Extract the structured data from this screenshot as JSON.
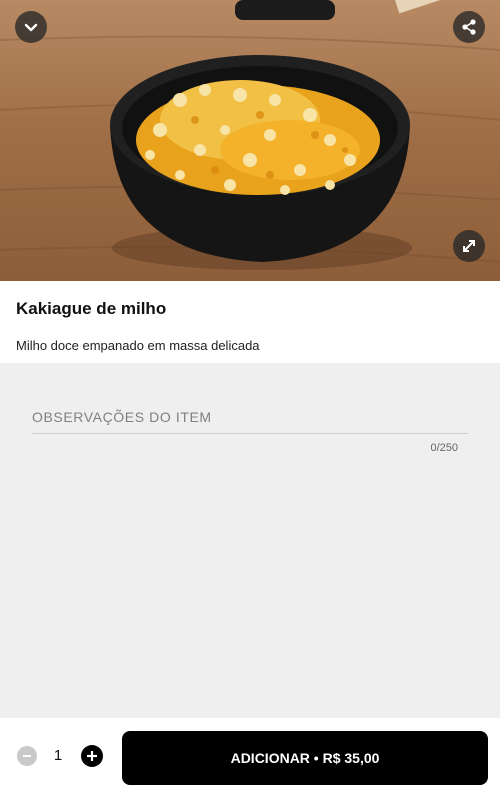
{
  "hero": {
    "image_description": "",
    "collapse_icon": "chevron-down-icon",
    "share_icon": "share-icon",
    "expand_icon": "expand-icon"
  },
  "item": {
    "title": "Kakiague de milho",
    "description": "Milho doce empanado em massa delicada"
  },
  "notes": {
    "placeholder": "OBSERVAÇÕES DO ITEM",
    "value": "",
    "counter": "0/250"
  },
  "order": {
    "quantity": "1",
    "add_label": "ADICIONAR • R$ 35,00"
  },
  "colors": {
    "primary": "#000000",
    "background": "#efefef",
    "card": "#ffffff"
  }
}
